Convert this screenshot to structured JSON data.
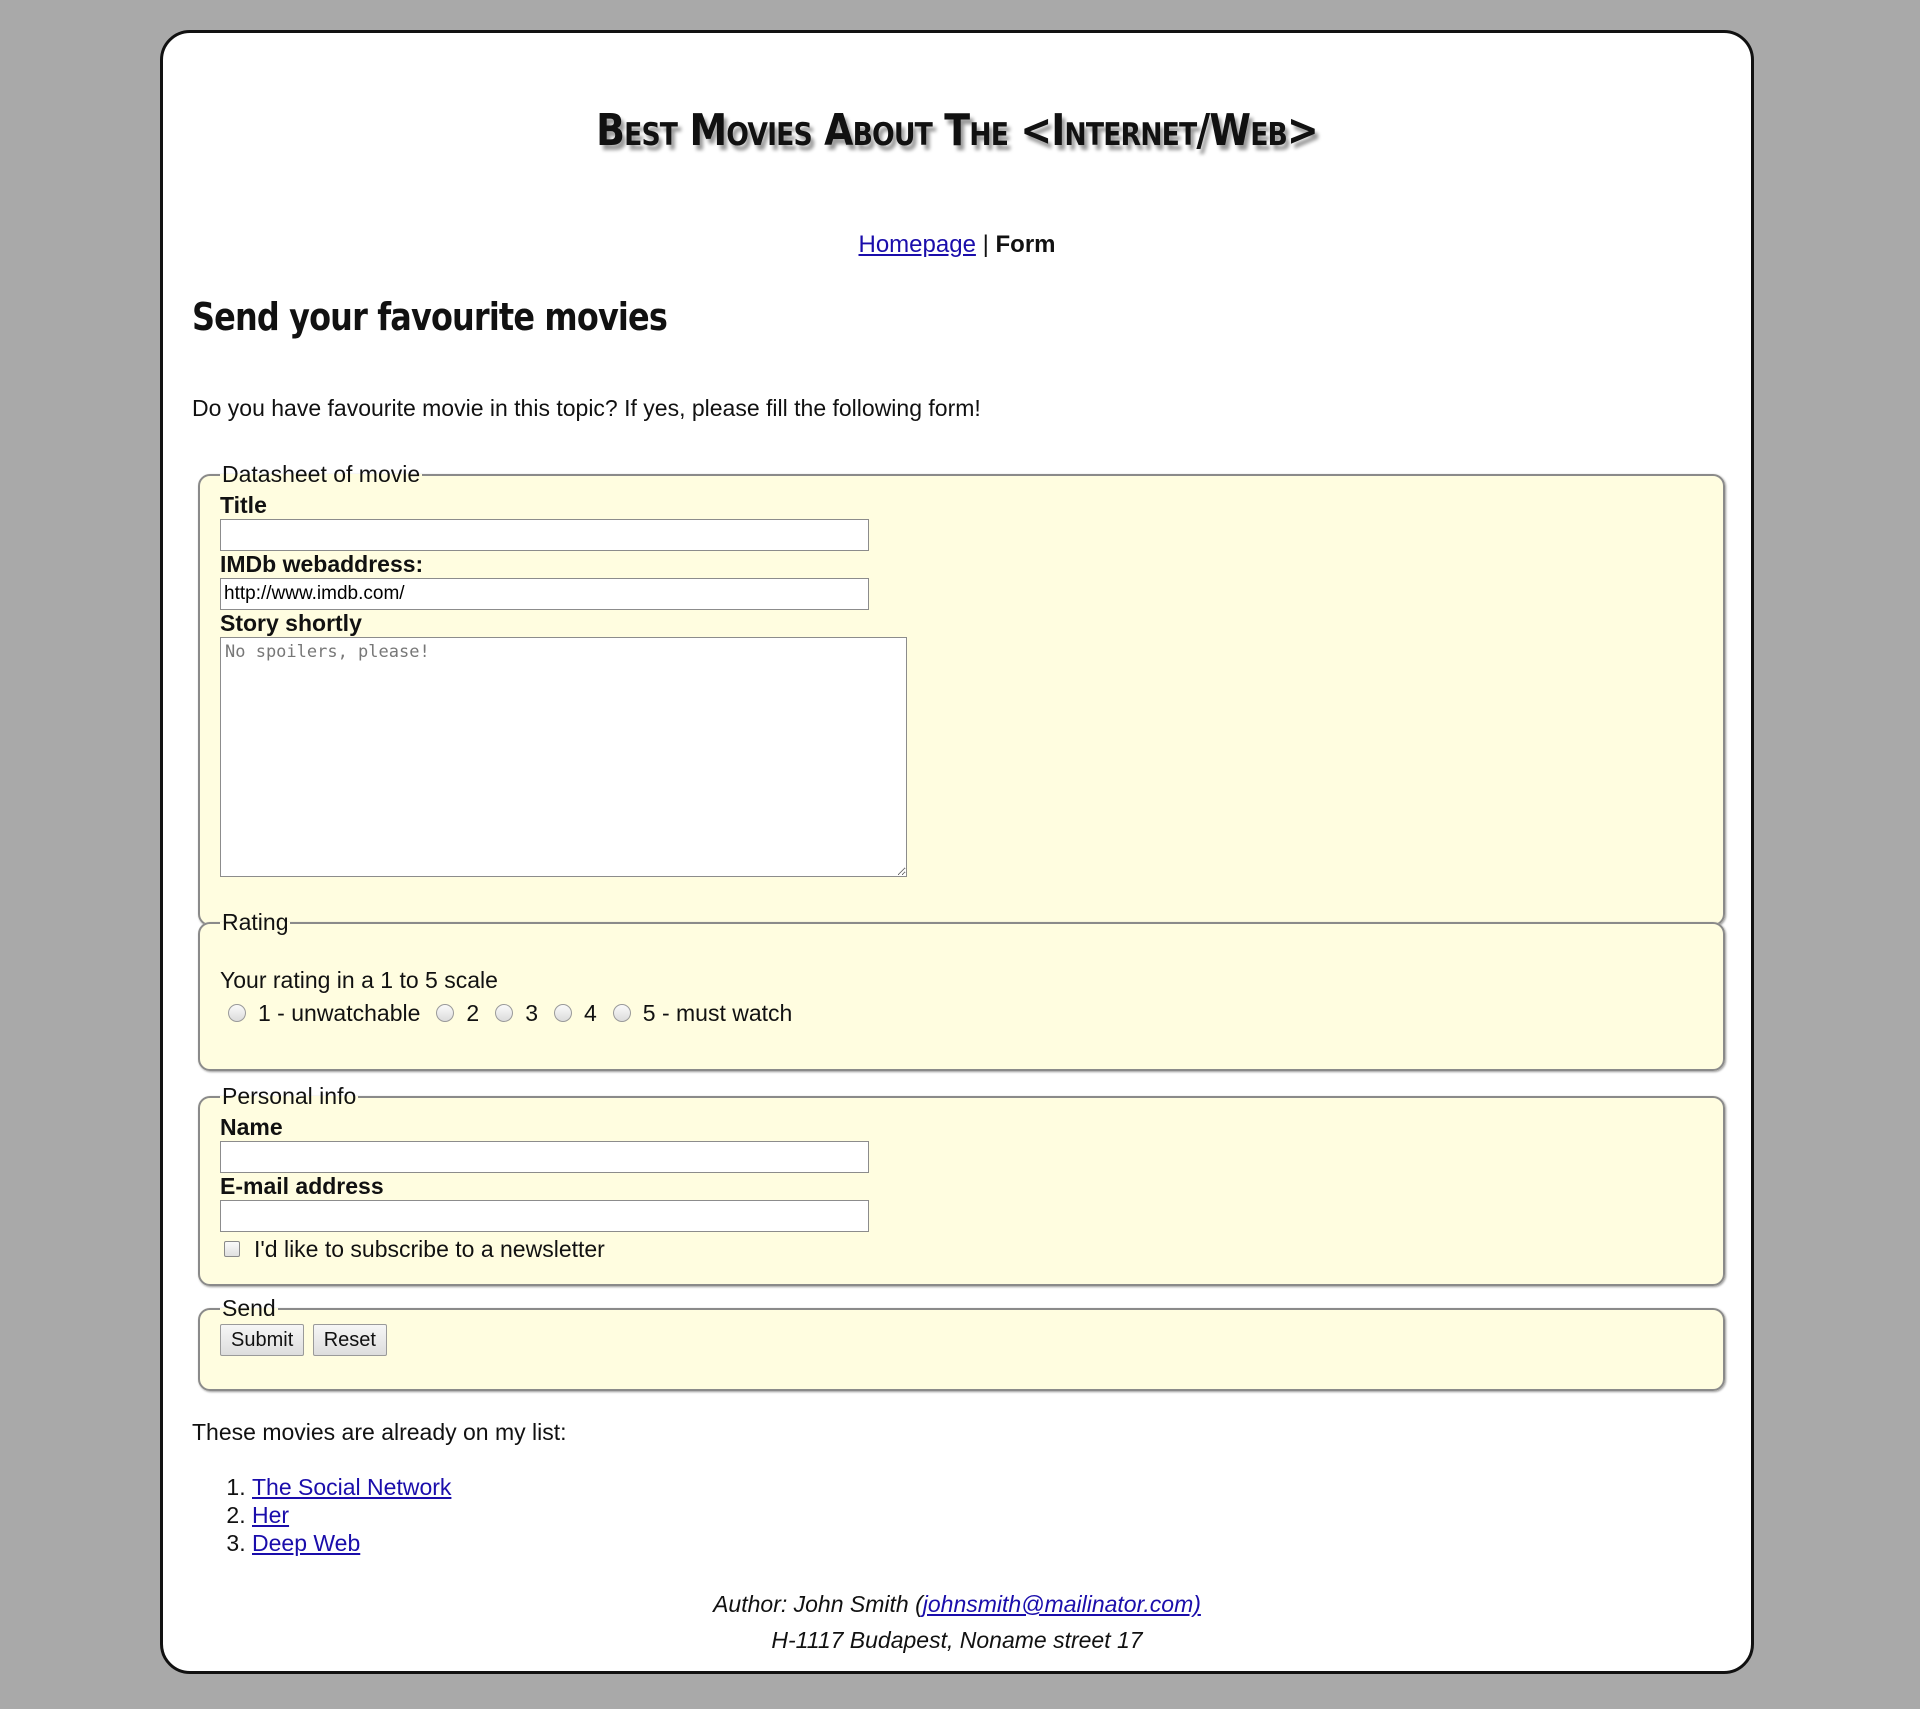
{
  "site": {
    "title": "Best Movies About The <Internet/Web>"
  },
  "nav": {
    "homepage": "Homepage",
    "separator": "|",
    "current": "Form"
  },
  "main": {
    "heading": "Send your favourite movies",
    "intro": "Do you have favourite movie in this topic? If yes, please fill the following form!"
  },
  "datasheet": {
    "legend": "Datasheet of movie",
    "title_label": "Title",
    "title_value": "",
    "imdb_label": "IMDb webaddress:",
    "imdb_value": "http://www.imdb.com/",
    "story_label": "Story shortly",
    "story_placeholder": "No spoilers, please!"
  },
  "rating": {
    "legend": "Rating",
    "prompt": "Your rating in a 1 to 5 scale",
    "options": [
      "1 - unwatchable",
      "2",
      "3",
      "4",
      "5 - must watch"
    ]
  },
  "personal": {
    "legend": "Personal info",
    "name_label": "Name",
    "email_label": "E-mail address",
    "newsletter_label": "I'd like to subscribe to a newsletter"
  },
  "send": {
    "legend": "Send",
    "submit_label": "Submit",
    "reset_label": "Reset"
  },
  "list": {
    "intro": "These movies are already on my list:",
    "movies": [
      "The Social Network",
      "Her",
      "Deep Web"
    ]
  },
  "footer": {
    "author_prefix": "Author: John Smith (",
    "email": "johnsmith@mailinator.com)",
    "address": "H-1117 Budapest, Noname street 17"
  }
}
